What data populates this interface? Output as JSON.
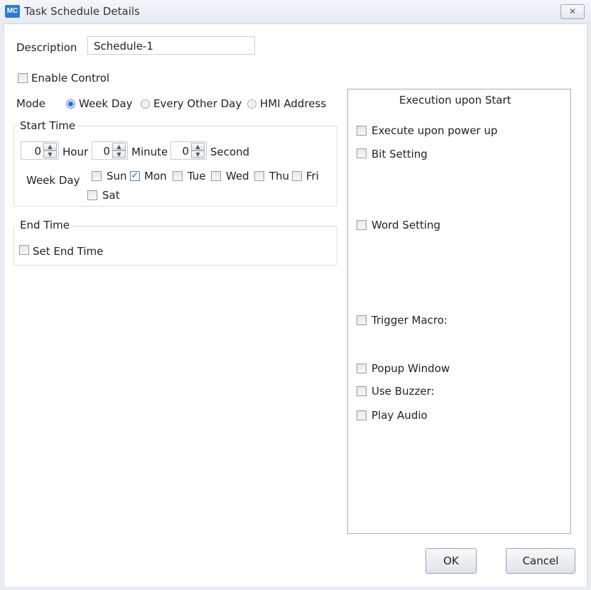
{
  "window": {
    "icon_text": "MC",
    "title": "Task Schedule Details",
    "close_glyph": "✕"
  },
  "description": {
    "label": "Description",
    "value": "Schedule-1"
  },
  "enable_control": {
    "label": "Enable Control",
    "checked": false
  },
  "mode": {
    "label": "Mode",
    "options": [
      {
        "label": "Week Day",
        "selected": true
      },
      {
        "label": "Every Other Day",
        "selected": false
      },
      {
        "label": "HMI Address",
        "selected": false
      }
    ]
  },
  "start_time": {
    "title": "Start Time",
    "hour": {
      "value": "0",
      "label": "Hour"
    },
    "minute": {
      "value": "0",
      "label": "Minute"
    },
    "second": {
      "value": "0",
      "label": "Second"
    },
    "week_day_label": "Week Day",
    "days": [
      {
        "label": "Sun",
        "checked": false
      },
      {
        "label": "Mon",
        "checked": true
      },
      {
        "label": "Tue",
        "checked": false
      },
      {
        "label": "Wed",
        "checked": false
      },
      {
        "label": "Thu",
        "checked": false
      },
      {
        "label": "Fri",
        "checked": false
      },
      {
        "label": "Sat",
        "checked": false
      }
    ]
  },
  "end_time": {
    "title": "End Time",
    "set_end_time": {
      "label": "Set End Time",
      "checked": false
    }
  },
  "execution": {
    "title": "Execution upon Start",
    "items": [
      {
        "label": "Execute upon power up",
        "checked": false
      },
      {
        "label": "Bit Setting",
        "checked": false
      },
      {
        "label": "Word Setting",
        "checked": false
      },
      {
        "label": "Trigger Macro:",
        "checked": false
      },
      {
        "label": "Popup Window",
        "checked": false
      },
      {
        "label": "Use Buzzer:",
        "checked": false
      },
      {
        "label": "Play Audio",
        "checked": false
      }
    ]
  },
  "buttons": {
    "ok": "OK",
    "cancel": "Cancel"
  },
  "colors": {
    "title_icon": "#2f7bd0",
    "check_mark": "#2a56a8",
    "radio_selected": "#2d6fd3"
  },
  "icons": {
    "checkmark": "✓",
    "spin_up": "▲",
    "spin_down": "▼"
  }
}
